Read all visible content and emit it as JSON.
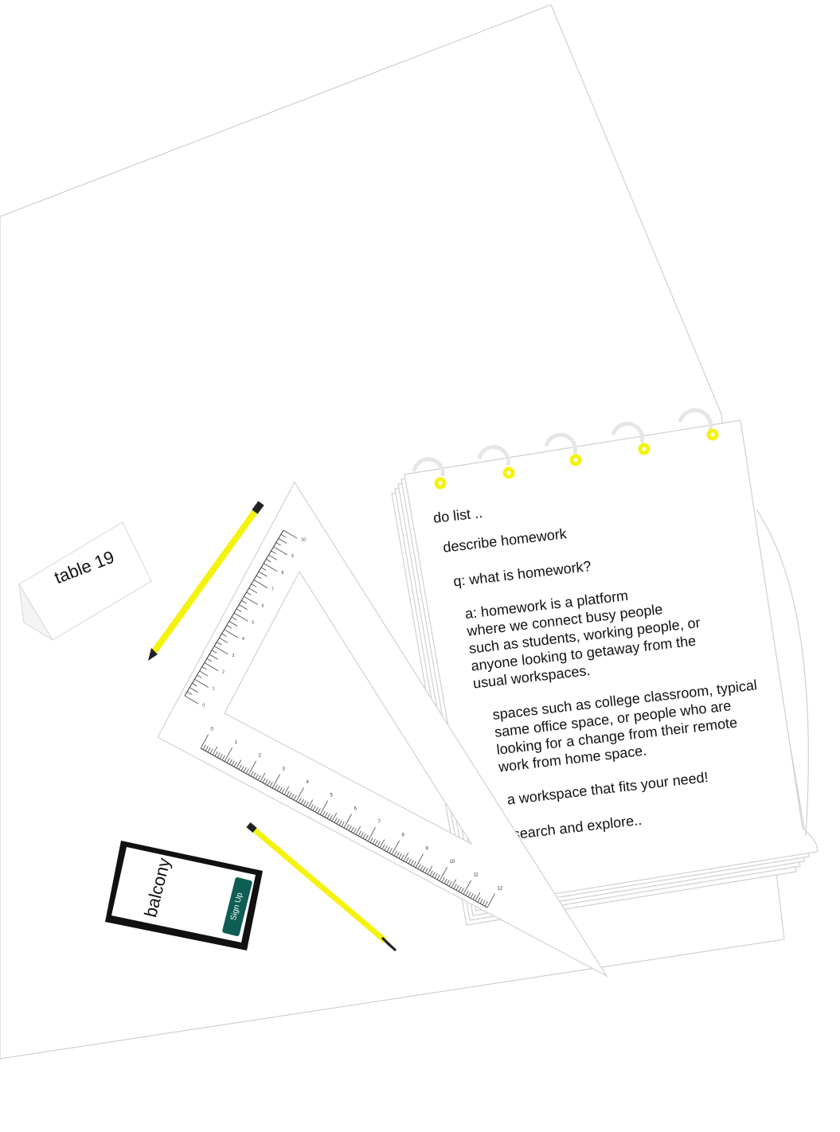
{
  "table_tent": {
    "label": "table 19"
  },
  "phone": {
    "label": "balcony",
    "button_label": "Sign Up"
  },
  "notepad": {
    "lines": [
      "do list ..",
      "describe homework",
      "q: what is homework?",
      "a: homework is a platform\nwhere we connect busy people\nsuch as students, working people, or\nanyone looking to getaway from the\nusual workspaces.",
      "spaces such as college classroom, typical\nsame office space, or people who are\nlooking for a change from their remote\nwork from home space.",
      "a workspace that fits your need!",
      "search and explore.."
    ]
  },
  "ruler_long": {
    "ticks": [
      "0",
      "1",
      "2",
      "3",
      "4",
      "5",
      "6",
      "7",
      "8",
      "9",
      "10",
      "11",
      "12"
    ]
  },
  "ruler_short": {
    "ticks": [
      "0",
      "1",
      "2",
      "3",
      "4",
      "5",
      "6",
      "7",
      "8",
      "9",
      "10"
    ]
  },
  "colors": {
    "pencil": "#f5f20d",
    "ring": "#f5f20d",
    "button": "#0f5e54",
    "paper_edge": "#cccccc"
  }
}
